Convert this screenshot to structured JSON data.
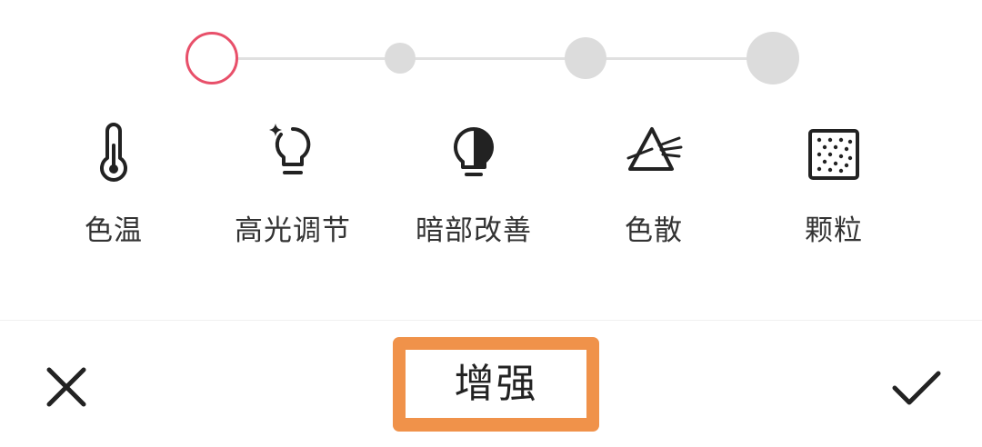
{
  "slider": {
    "selected_index": 0,
    "levels": 4,
    "active_color": "#e8506a",
    "inactive_color": "#dcdcdc"
  },
  "tools": [
    {
      "label": "色温",
      "icon": "thermometer-icon"
    },
    {
      "label": "高光调节",
      "icon": "lightbulb-sparkle-icon"
    },
    {
      "label": "暗部改善",
      "icon": "lightbulb-half-icon"
    },
    {
      "label": "色散",
      "icon": "prism-icon"
    },
    {
      "label": "颗粒",
      "icon": "grain-icon"
    }
  ],
  "bottom_bar": {
    "title": "增强",
    "cancel_icon": "close-icon",
    "confirm_icon": "checkmark-icon",
    "highlight_color": "#f0924a"
  }
}
